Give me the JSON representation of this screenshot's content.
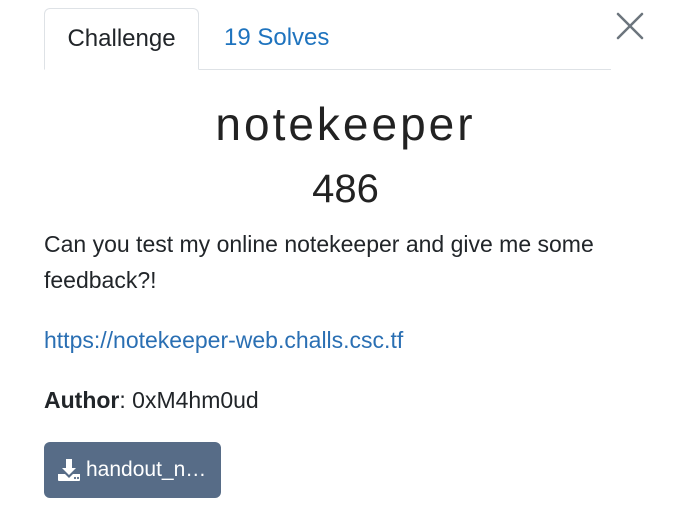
{
  "tabs": {
    "challenge_label": "Challenge",
    "solves_label": "19 Solves"
  },
  "challenge": {
    "name": "notekeeper",
    "points": "486",
    "description": "Can you test my online notekeeper and give me some feedback?!",
    "url": "https://notekeeper-web.challs.csc.tf",
    "author_label": "Author",
    "author_sep": ": ",
    "author_name": "0xM4hm0ud"
  },
  "download": {
    "label": "handout_notekeeper.zip",
    "icon": "download-icon"
  },
  "close": {
    "icon": "close-icon"
  },
  "colors": {
    "link": "#2a6fb3",
    "tab_link": "#1e73be",
    "button": "#576c87"
  }
}
